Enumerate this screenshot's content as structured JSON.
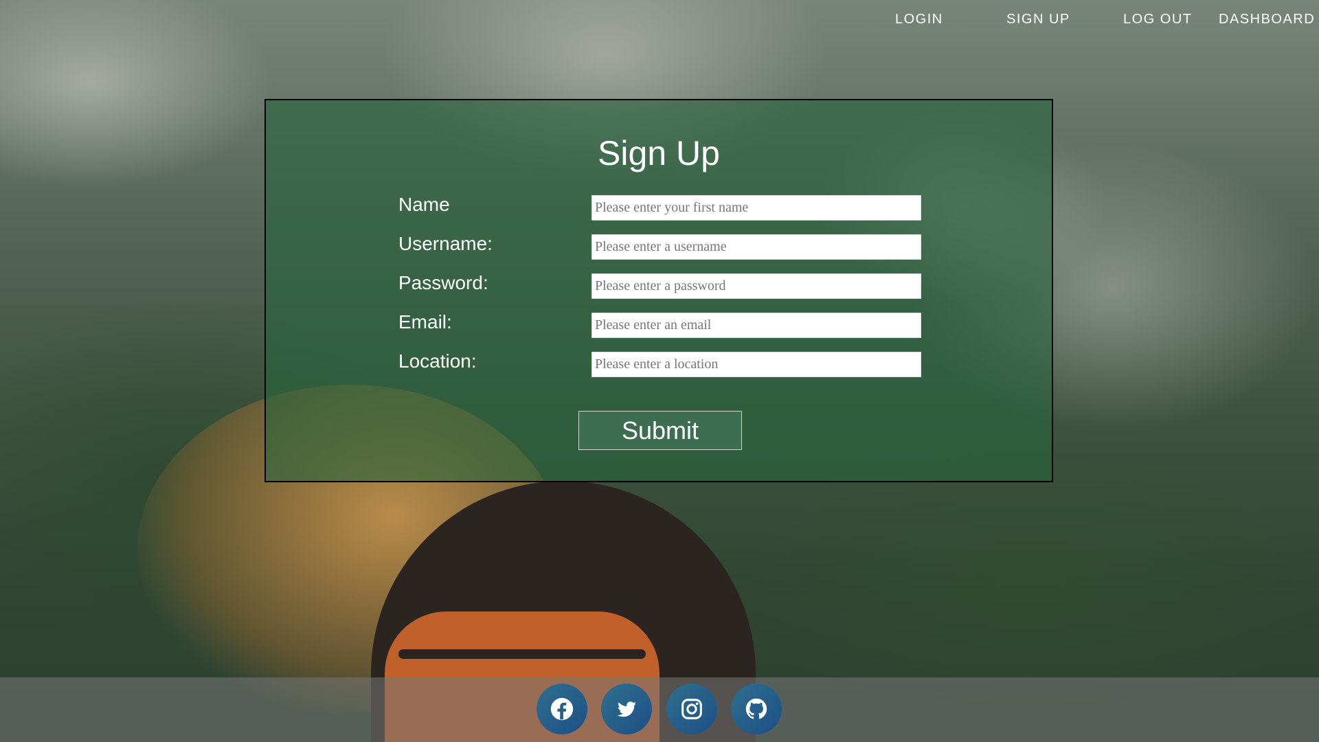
{
  "nav": {
    "items": [
      {
        "label": "LOGIN"
      },
      {
        "label": "SIGN UP"
      },
      {
        "label": "LOG OUT"
      },
      {
        "label": "DASHBOARD"
      }
    ]
  },
  "form": {
    "title": "Sign Up",
    "fields": [
      {
        "label": "Name",
        "placeholder": "Please enter your first name"
      },
      {
        "label": "Username:",
        "placeholder": "Please enter a username"
      },
      {
        "label": "Password:",
        "placeholder": "Please enter a password"
      },
      {
        "label": "Email:",
        "placeholder": "Please enter an email"
      },
      {
        "label": "Location:",
        "placeholder": "Please enter a location"
      }
    ],
    "submit_label": "Submit"
  },
  "footer": {
    "icons": [
      "facebook-icon",
      "twitter-icon",
      "instagram-icon",
      "github-icon"
    ]
  },
  "colors": {
    "panel": "#28643c",
    "submit": "#3d6e52",
    "social": "#1d4f86"
  }
}
